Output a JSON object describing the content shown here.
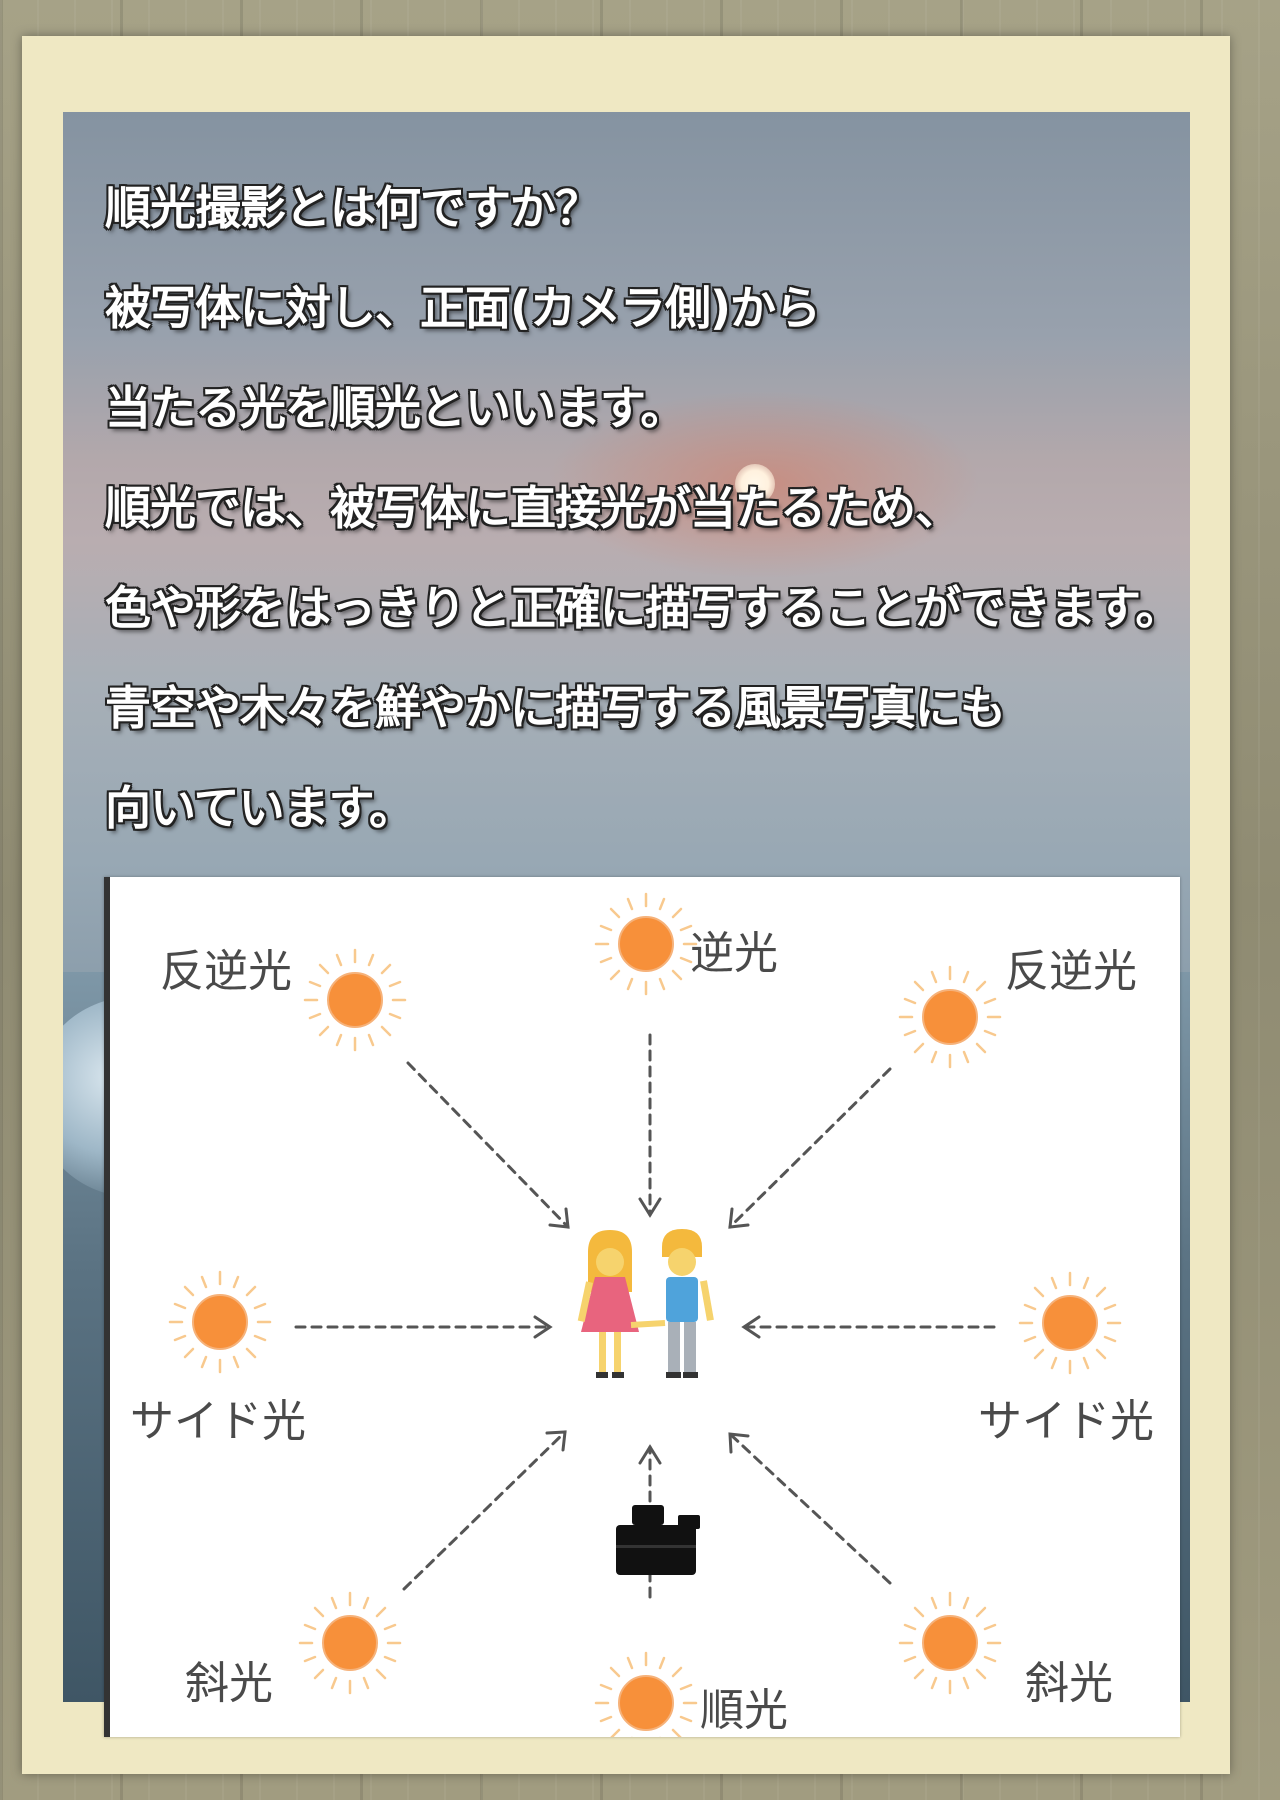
{
  "text": {
    "lines": [
      "順光撮影とは何ですか？",
      "被写体に対し、正面(カメラ側)から",
      "当たる光を順光といいます。",
      "順光では、被写体に直接光が当たるため、",
      "色や形をはっきりと正確に描写することができます。",
      " 青空や木々を鮮やかに描写する風景写真にも",
      "向いています。"
    ]
  },
  "diagram": {
    "labels": {
      "back_light": "逆光",
      "rim_left": "反逆光",
      "rim_right": "反逆光",
      "side_left": "サイド光",
      "side_right": "サイド光",
      "oblique_left": "斜光",
      "oblique_right": "斜光",
      "front_light": "順光"
    },
    "icons": {
      "sun": "sun-icon",
      "subject": "couple-icon",
      "camera": "camera-icon"
    },
    "colors": {
      "sun": "#f7903a",
      "sun_rays": "#f8c98e",
      "arrow": "#555555"
    }
  }
}
